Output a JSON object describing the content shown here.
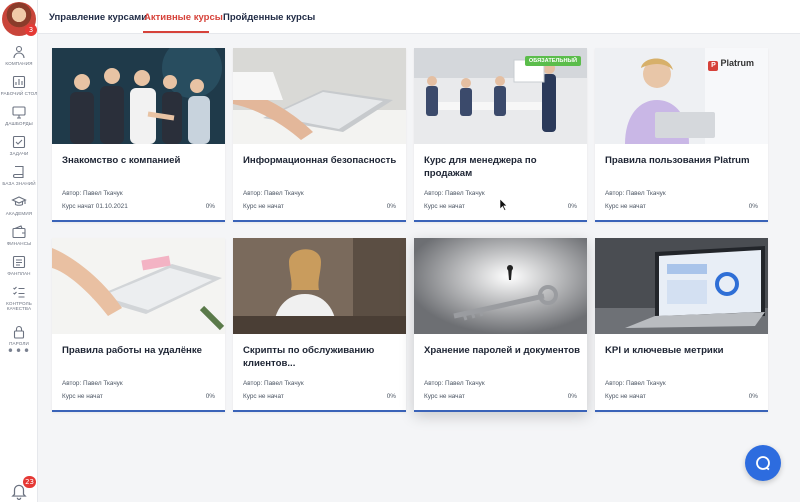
{
  "sidebar": {
    "avatar_badge": "3",
    "items": [
      {
        "label": "компания",
        "icon": "company-icon"
      },
      {
        "label": "рабочий стол",
        "icon": "desktop-icon"
      },
      {
        "label": "дашборды",
        "icon": "monitor-icon"
      },
      {
        "label": "задачи",
        "icon": "tasks-icon"
      },
      {
        "label": "база знаний",
        "icon": "book-icon"
      },
      {
        "label": "академия",
        "icon": "graduation-cap-icon"
      },
      {
        "label": "финансы",
        "icon": "wallet-icon"
      },
      {
        "label": "фанплан",
        "icon": "plan-icon"
      },
      {
        "label": "контроль качества",
        "icon": "checklist-icon"
      },
      {
        "label": "пароли",
        "icon": "lock-icon"
      }
    ],
    "more": "•••",
    "bell_badge": "23"
  },
  "tabs": [
    {
      "label": "Управление курсами",
      "active": false
    },
    {
      "label": "Активные курсы",
      "active": true
    },
    {
      "label": "Пройденные курсы",
      "active": false
    }
  ],
  "accent_color": "#d6423a",
  "progress_color": "#3a63b8",
  "courses": [
    {
      "title": "Знакомство с компанией",
      "author": "Автор: Павел Ткачук",
      "status": "Курс начат 01.10.2021",
      "progress": "0%"
    },
    {
      "title": "Информационная безопасность",
      "author": "Автор: Павел Ткачук",
      "status": "Курс не начат",
      "progress": "0%"
    },
    {
      "title": "Курс для менеджера по продажам",
      "author": "Автор: Павел Ткачук",
      "status": "Курс не начат",
      "progress": "0%",
      "tag": "ОБЯЗАТЕЛЬНЫЙ"
    },
    {
      "title": "Правила пользования Platrum",
      "author": "Автор: Павел Ткачук",
      "status": "Курс не начат",
      "progress": "0%",
      "brand": "Platrum"
    },
    {
      "title": "Правила работы на удалёнке",
      "author": "Автор: Павел Ткачук",
      "status": "Курс не начат",
      "progress": "0%"
    },
    {
      "title": "Скрипты по обслуживанию клиентов...",
      "author": "Автор: Павел Ткачук",
      "status": "Курс не начат",
      "progress": "0%"
    },
    {
      "title": "Хранение паролей и документов",
      "author": "Автор: Павел Ткачук",
      "status": "Курс не начат",
      "progress": "0%"
    },
    {
      "title": "KPI и ключевые метрики",
      "author": "Автор: Павел Ткачук",
      "status": "Курс не начат",
      "progress": "0%"
    }
  ]
}
